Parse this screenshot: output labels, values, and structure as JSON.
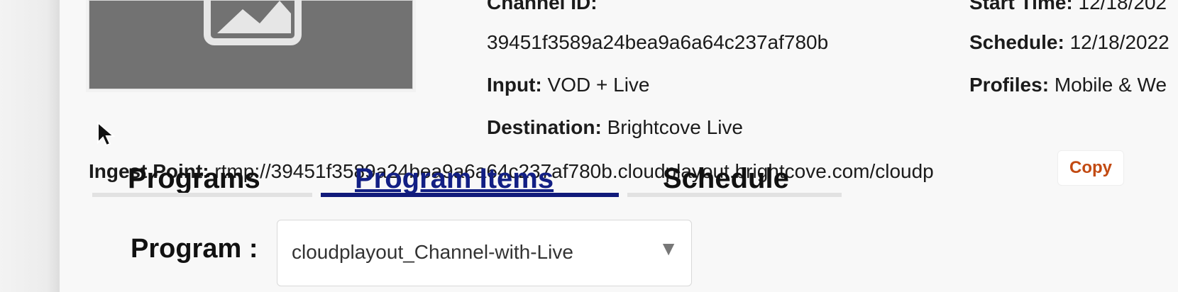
{
  "channel": {
    "id_label": "Channel ID:",
    "id_value": "39451f3589a24bea9a6a64c237af780b",
    "input_label": "Input:",
    "input_value": "VOD + Live",
    "destination_label": "Destination:",
    "destination_value": "Brightcove Live",
    "start_label": "Start Time:",
    "start_value": "12/18/202",
    "schedule_label": "Schedule:",
    "schedule_value": "12/18/2022",
    "profiles_label": "Profiles:",
    "profiles_value": "Mobile & We"
  },
  "ingest": {
    "label": "Ingest Point:",
    "value": "rtmp://39451f3589a24bea9a6a64c237af780b.cloudplayout.brightcove.com/cloudp",
    "copy_label": "Copy"
  },
  "tabs": [
    {
      "label": "Programs",
      "active": false
    },
    {
      "label": "Program Items",
      "active": true
    },
    {
      "label": "Schedule",
      "active": false
    }
  ],
  "program": {
    "label": "Program :",
    "selected": "cloudplayout_Channel-with-Live"
  },
  "icons": {
    "thumbnail": "image-placeholder-icon",
    "cursor": "mouse-cursor-icon",
    "dropdown": "caret-down-icon"
  },
  "colors": {
    "accent_active_tab": "#121f84",
    "copy_text": "#c24a12"
  }
}
